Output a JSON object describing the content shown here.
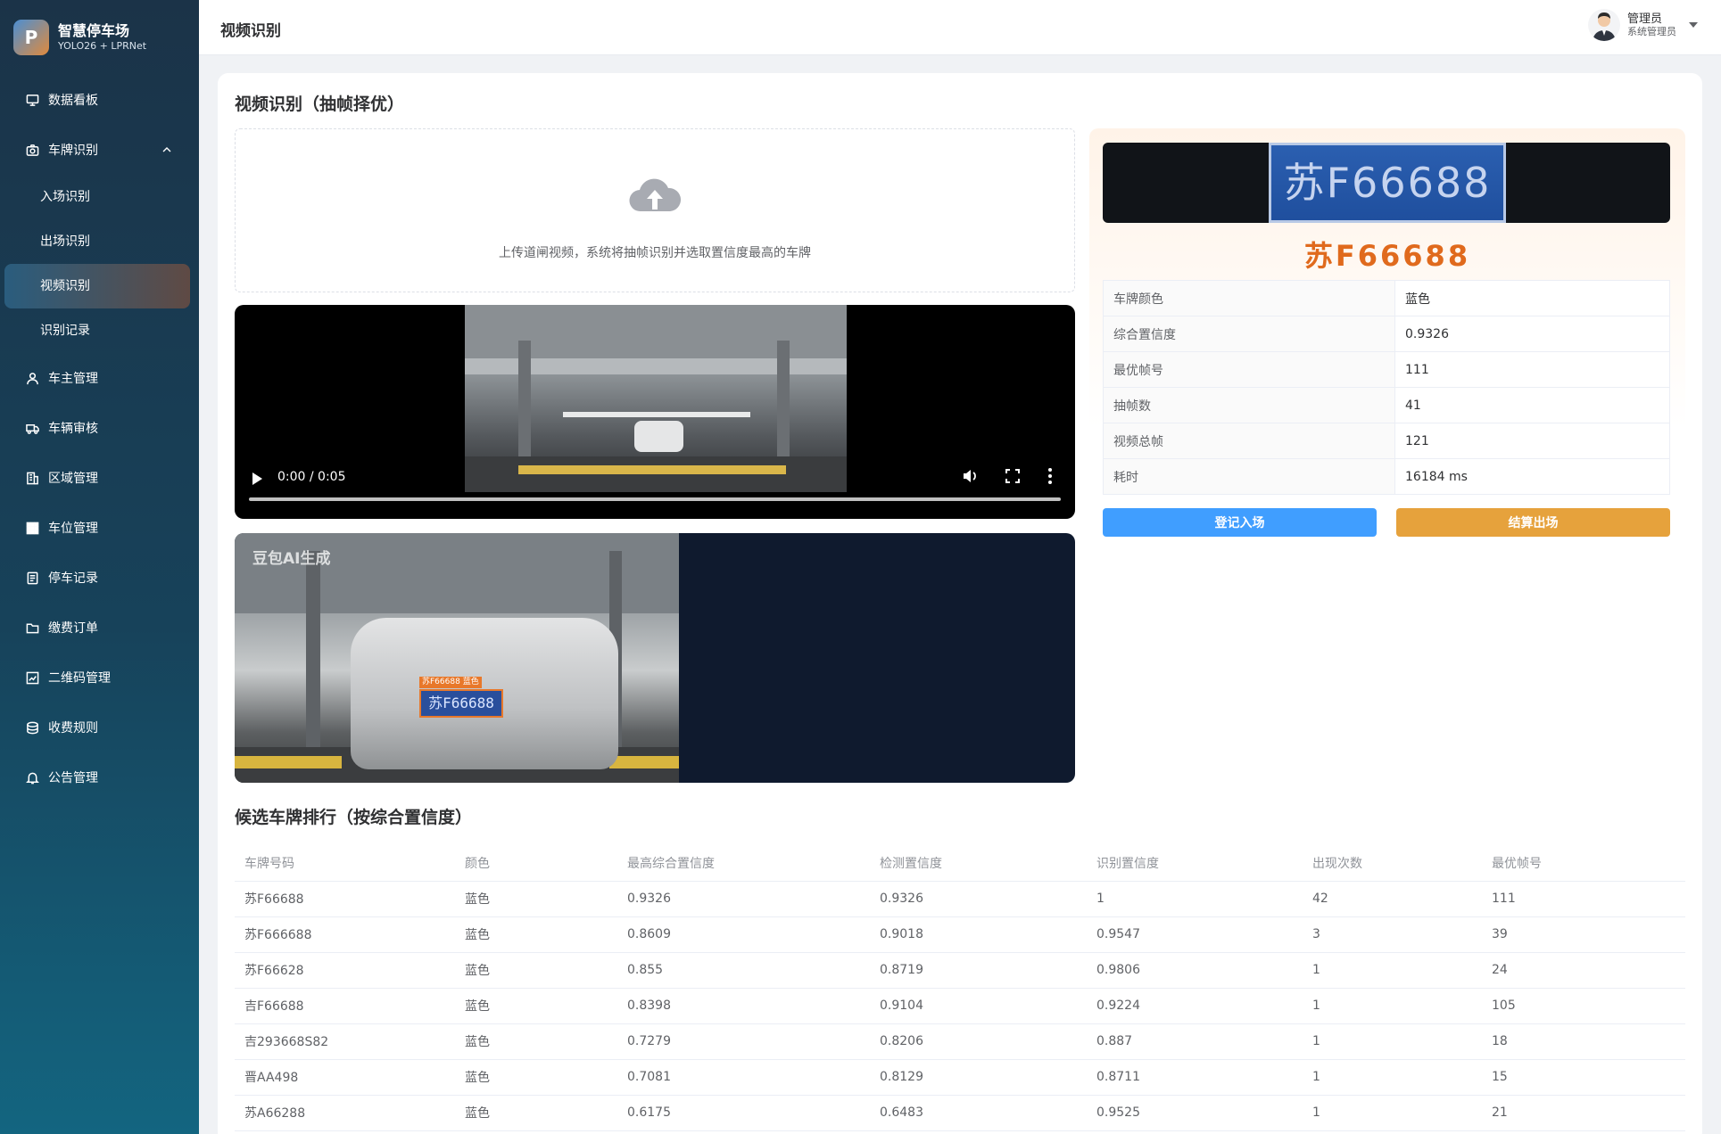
{
  "brand": {
    "logo_letter": "P",
    "name": "智慧停车场",
    "subtitle": "YOLO26 + LPRNet"
  },
  "sidebar": {
    "items": [
      {
        "label": "数据看板",
        "icon": "monitor-icon"
      },
      {
        "label": "车牌识别",
        "icon": "camera-icon",
        "expanded": true,
        "children": [
          {
            "label": "入场识别"
          },
          {
            "label": "出场识别"
          },
          {
            "label": "视频识别",
            "active": true
          },
          {
            "label": "识别记录"
          }
        ]
      },
      {
        "label": "车主管理",
        "icon": "user-icon"
      },
      {
        "label": "车辆审核",
        "icon": "truck-icon"
      },
      {
        "label": "区域管理",
        "icon": "building-icon"
      },
      {
        "label": "车位管理",
        "icon": "grid-icon"
      },
      {
        "label": "停车记录",
        "icon": "document-icon"
      },
      {
        "label": "缴费订单",
        "icon": "folder-icon"
      },
      {
        "label": "二维码管理",
        "icon": "chart-icon"
      },
      {
        "label": "收费规则",
        "icon": "coins-icon"
      },
      {
        "label": "公告管理",
        "icon": "bell-icon"
      }
    ]
  },
  "header": {
    "title": "视频识别",
    "user_name": "管理员",
    "user_role": "系统管理员"
  },
  "main": {
    "title": "视频识别（抽帧择优）",
    "upload_hint": "上传道闸视频，系统将抽帧识别并选取置信度最高的车牌",
    "video": {
      "time": "0:00 / 0:05",
      "progress": 0
    },
    "best_frame": {
      "watermark": "豆包AI生成",
      "detected_plate": "苏F66688",
      "detected_color": "蓝色"
    }
  },
  "result": {
    "plate_image_text": "苏F66688",
    "plate": "苏F66688",
    "plate_color_hex": "#e06a1d",
    "rows": [
      {
        "key": "车牌颜色",
        "value": "蓝色"
      },
      {
        "key": "综合置信度",
        "value": "0.9326"
      },
      {
        "key": "最优帧号",
        "value": "111"
      },
      {
        "key": "抽帧数",
        "value": "41"
      },
      {
        "key": "视频总帧",
        "value": "121"
      },
      {
        "key": "耗时",
        "value": "16184 ms"
      }
    ],
    "btn_in": "登记入场",
    "btn_out": "结算出场"
  },
  "ranking": {
    "title": "候选车牌排行（按综合置信度）",
    "columns": [
      "车牌号码",
      "颜色",
      "最高综合置信度",
      "检测置信度",
      "识别置信度",
      "出现次数",
      "最优帧号"
    ],
    "rows": [
      [
        "苏F66688",
        "蓝色",
        "0.9326",
        "0.9326",
        "1",
        "42",
        "111"
      ],
      [
        "苏F666688",
        "蓝色",
        "0.8609",
        "0.9018",
        "0.9547",
        "3",
        "39"
      ],
      [
        "苏F66628",
        "蓝色",
        "0.855",
        "0.8719",
        "0.9806",
        "1",
        "24"
      ],
      [
        "吉F66688",
        "蓝色",
        "0.8398",
        "0.9104",
        "0.9224",
        "1",
        "105"
      ],
      [
        "吉293668S82",
        "蓝色",
        "0.7279",
        "0.8206",
        "0.887",
        "1",
        "18"
      ],
      [
        "晋AA498",
        "蓝色",
        "0.7081",
        "0.8129",
        "0.8711",
        "1",
        "15"
      ],
      [
        "苏A66288",
        "蓝色",
        "0.6175",
        "0.6483",
        "0.9525",
        "1",
        "21"
      ]
    ]
  }
}
